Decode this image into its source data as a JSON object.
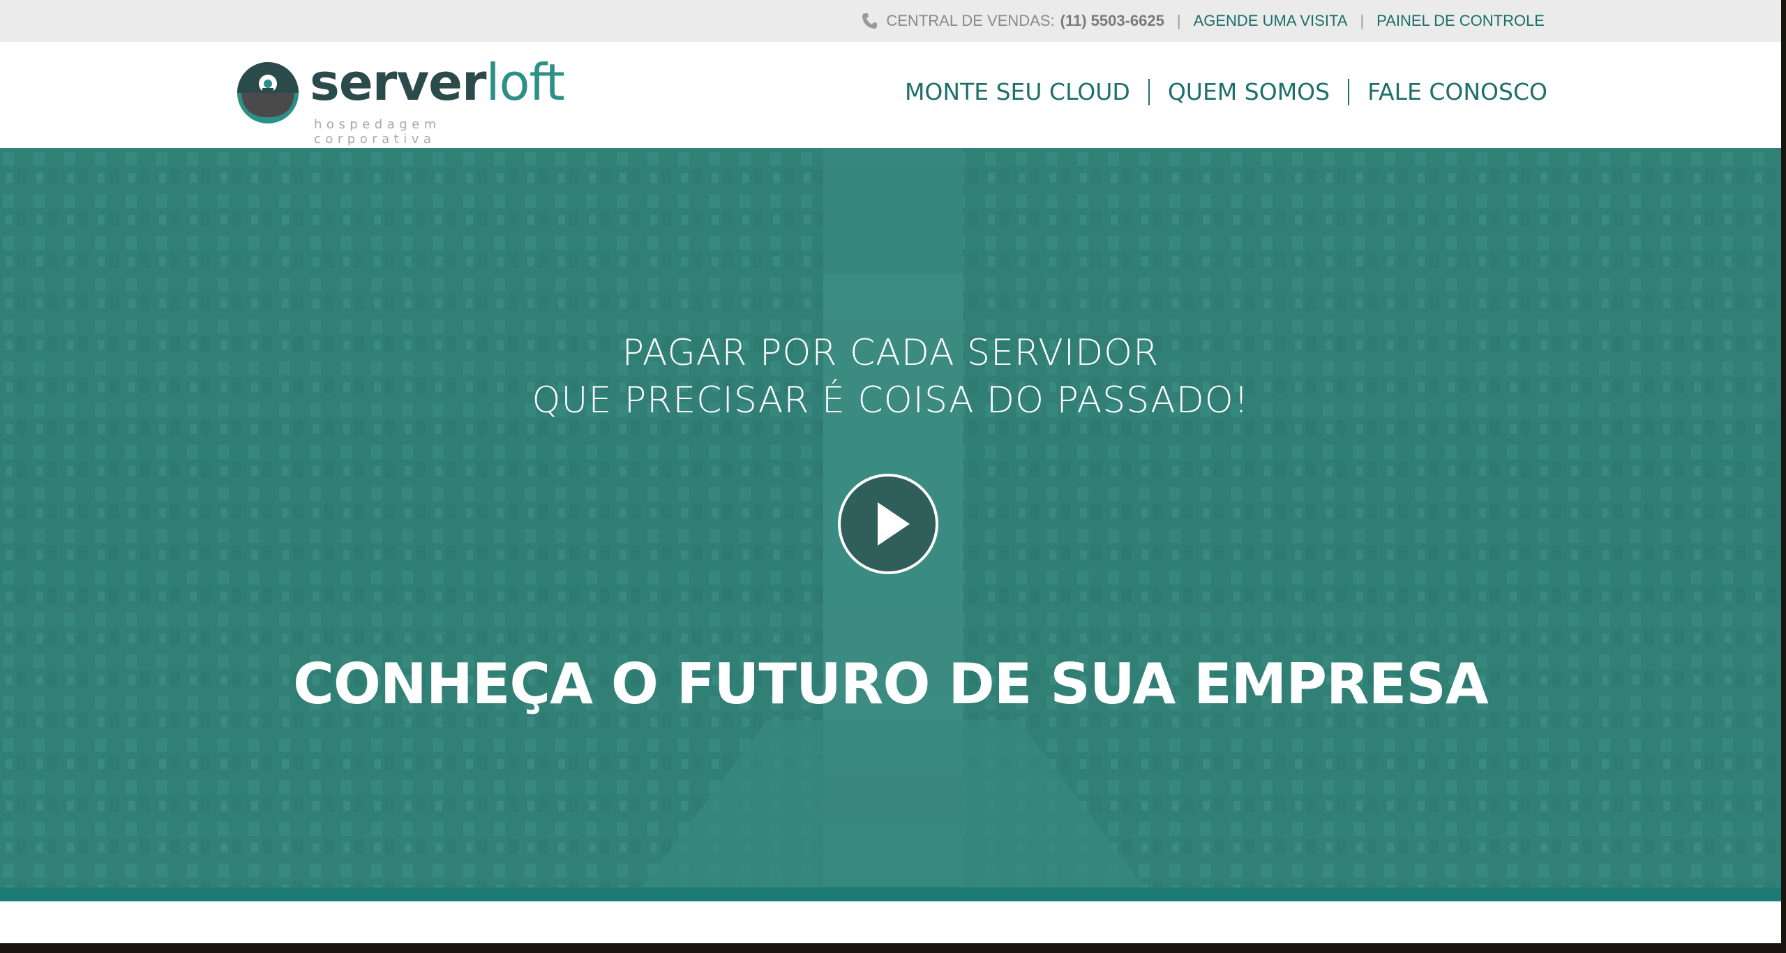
{
  "topbar": {
    "sales_label": "CENTRAL DE VENDAS:",
    "sales_number": "(11) 5503-6625",
    "link_visit": "AGENDE UMA VISITA",
    "link_panel": "PAINEL DE CONTROLE",
    "separator": "|",
    "phone_icon": "phone-icon"
  },
  "logo": {
    "word_bold": "server",
    "word_light": "loft",
    "tagline": "hospedagem corporativa"
  },
  "nav": {
    "items": [
      "MONTE SEU CLOUD",
      "QUEM SOMOS",
      "FALE CONOSCO"
    ]
  },
  "hero": {
    "line1": "PAGAR POR CADA SERVIDOR",
    "line2": "QUE PRECISAR É COISA DO PASSADO!",
    "cta": "CONHEÇA O FUTURO DE SUA EMPRESA",
    "play_icon": "play-icon"
  },
  "colors": {
    "accent": "#1d6f6b",
    "hero_overlay": "#3a8a80",
    "stripe": "#1d7a74",
    "topbar_bg": "#ebebeb"
  }
}
